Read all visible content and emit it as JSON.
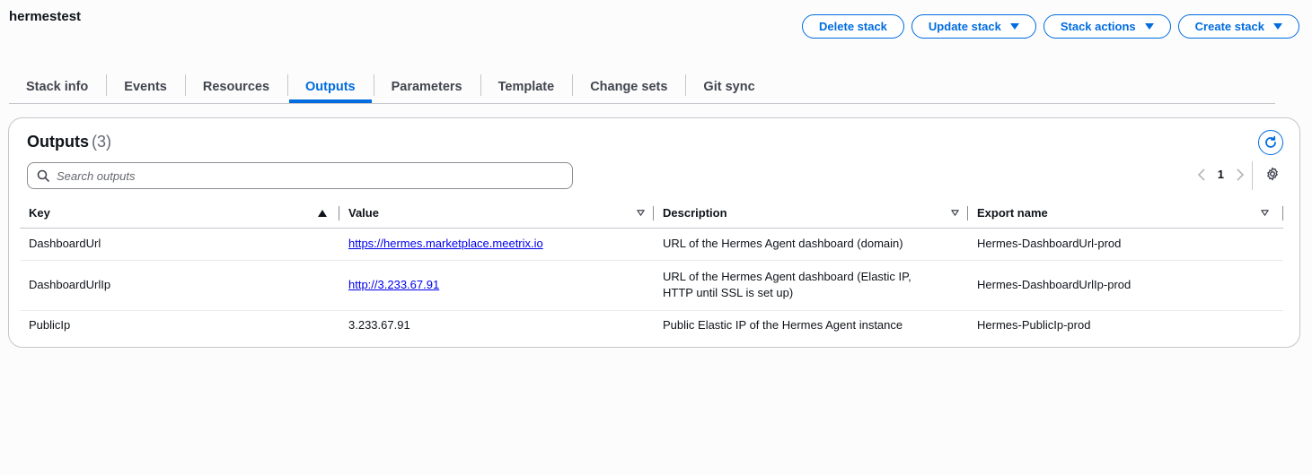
{
  "header": {
    "title": "hermestest",
    "buttons": {
      "delete": "Delete stack",
      "update": "Update stack",
      "actions": "Stack actions",
      "create": "Create stack"
    }
  },
  "tabs": [
    {
      "label": "Stack info"
    },
    {
      "label": "Events"
    },
    {
      "label": "Resources"
    },
    {
      "label": "Outputs",
      "active": true
    },
    {
      "label": "Parameters"
    },
    {
      "label": "Template"
    },
    {
      "label": "Change sets"
    },
    {
      "label": "Git sync"
    }
  ],
  "outputs": {
    "title": "Outputs",
    "count": "(3)",
    "search_placeholder": "Search outputs",
    "page": "1",
    "columns": [
      "Key",
      "Value",
      "Description",
      "Export name"
    ],
    "rows": [
      {
        "key": "DashboardUrl",
        "value": "https://hermes.marketplace.meetrix.io",
        "value_is_link": true,
        "description": "URL of the Hermes Agent dashboard (domain)",
        "export": "Hermes-DashboardUrl-prod"
      },
      {
        "key": "DashboardUrlIp",
        "value": "http://3.233.67.91",
        "value_is_link": true,
        "description": "URL of the Hermes Agent dashboard (Elastic IP, HTTP until SSL is set up)",
        "export": "Hermes-DashboardUrlIp-prod"
      },
      {
        "key": "PublicIp",
        "value": "3.233.67.91",
        "value_is_link": false,
        "description": "Public Elastic IP of the Hermes Agent instance",
        "export": "Hermes-PublicIp-prod"
      }
    ]
  },
  "colors": {
    "accent": "#006ce0",
    "text": "#0f141a",
    "border": "#c6c6cd"
  }
}
